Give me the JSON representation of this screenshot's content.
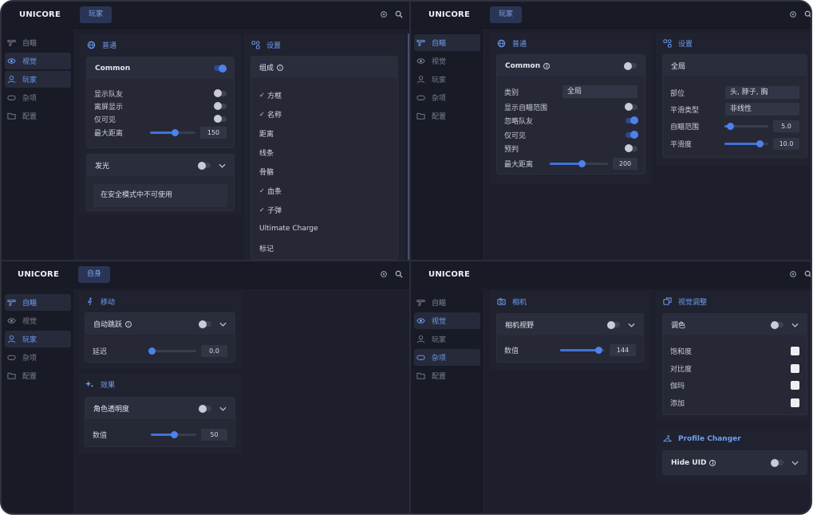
{
  "app": {
    "logo": "UNICORE"
  },
  "nav": {
    "aimbot": "自瞄",
    "visuals": "视觉",
    "players": "玩家",
    "misc": "杂项",
    "config": "配置"
  },
  "tl": {
    "tab": "玩家",
    "general": {
      "title": "普通",
      "common": "Common",
      "rows": [
        {
          "label": "显示队友"
        },
        {
          "label": "离屏显示"
        },
        {
          "label": "仅可见"
        }
      ],
      "distance": {
        "label": "最大距离",
        "value": "150",
        "fraction": 0.55
      }
    },
    "glow": {
      "title": "发光",
      "note": "在安全模式中不可使用"
    },
    "settings": {
      "title": "设置",
      "group": "组成",
      "items": [
        {
          "label": "方框",
          "checked": true
        },
        {
          "label": "名称",
          "checked": true
        },
        {
          "label": "距离",
          "checked": false
        },
        {
          "label": "线条",
          "checked": false
        },
        {
          "label": "骨骼",
          "checked": false
        },
        {
          "label": "血条",
          "checked": true
        },
        {
          "label": "子弹",
          "checked": true
        },
        {
          "label": "Ultimate Charge",
          "checked": false
        },
        {
          "label": "标记",
          "checked": false
        }
      ]
    }
  },
  "tr": {
    "tab": "玩家",
    "general": {
      "title": "普通",
      "common": "Common",
      "category_label": "类别",
      "category_value": "全局",
      "rows": [
        {
          "label": "显示自瞄范围",
          "on": false
        },
        {
          "label": "忽略队友",
          "on": true
        },
        {
          "label": "仅可见",
          "on": true
        },
        {
          "label": "预判",
          "on": false
        }
      ],
      "distance": {
        "label": "最大距离",
        "value": "200",
        "fraction": 0.55
      }
    },
    "settings": {
      "title": "设置",
      "head": "全局",
      "part_label": "部位",
      "part_value": "头, 脖子, 胸",
      "smooth_type_label": "平滑类型",
      "smooth_type_value": "非线性",
      "range": {
        "label": "自瞄范围",
        "value": "5.0",
        "fraction": 0.12
      },
      "smooth": {
        "label": "平滑度",
        "value": "10.0",
        "fraction": 0.8
      }
    }
  },
  "bl": {
    "tab": "自身",
    "movement": {
      "title": "移动",
      "auto_jump": "自动跳跃",
      "delay": {
        "label": "延迟",
        "value": "0.0",
        "fraction": 0.0
      }
    },
    "effects": {
      "title": "效果",
      "transparency": "角色透明度",
      "value": {
        "label": "数值",
        "value": "50",
        "fraction": 0.5
      }
    }
  },
  "br": {
    "camera": {
      "title": "相机",
      "fov": "相机视野",
      "value": {
        "label": "数值",
        "value": "144",
        "fraction": 0.85
      }
    },
    "visual_adjust": {
      "title": "视觉调整",
      "color": "调色",
      "items": [
        {
          "label": "饱和度"
        },
        {
          "label": "对比度"
        },
        {
          "label": "伽玛"
        },
        {
          "label": "添加"
        }
      ]
    },
    "profile": {
      "title": "Profile Changer",
      "hide_uid": "Hide UID"
    }
  }
}
